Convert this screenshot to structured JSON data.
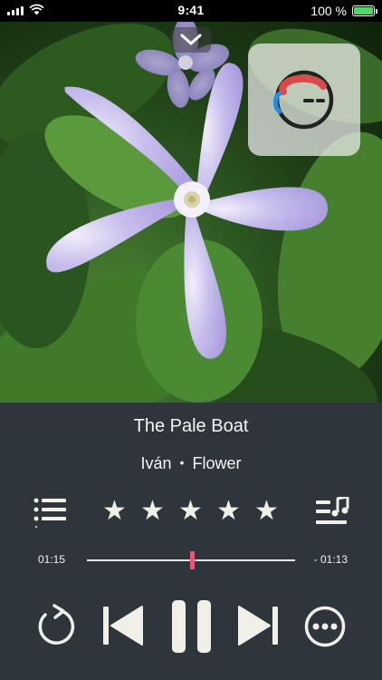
{
  "status_bar": {
    "time": "9:41",
    "battery_percent": "100 %",
    "battery_level": 1.0,
    "battery_color": "#4cd964",
    "icons": [
      "cellular-signal-icon",
      "wifi-icon",
      "battery-icon"
    ]
  },
  "artwork": {
    "dismiss_icon": "chevron-down-icon",
    "badge_icon": "app-logo-face-icon"
  },
  "track": {
    "title": "The Pale Boat",
    "artist": "Iván",
    "separator": "•",
    "album": "Flower"
  },
  "rating": {
    "stars": 5,
    "star_glyph": "★"
  },
  "progress": {
    "elapsed": "01:15",
    "remaining": "- 01:13",
    "fraction": 0.505,
    "thumb_color": "#e8587a"
  },
  "controls": {
    "left_icon": "queue-list-icon",
    "right_icon": "lyrics-icon",
    "repeat_icon": "repeat-icon",
    "prev_icon": "previous-track-icon",
    "play_icon": "pause-icon",
    "next_icon": "next-track-icon",
    "more_icon": "more-options-icon"
  },
  "colors": {
    "panel_bg": "#2e353b",
    "foreground": "#f0f0e8"
  }
}
